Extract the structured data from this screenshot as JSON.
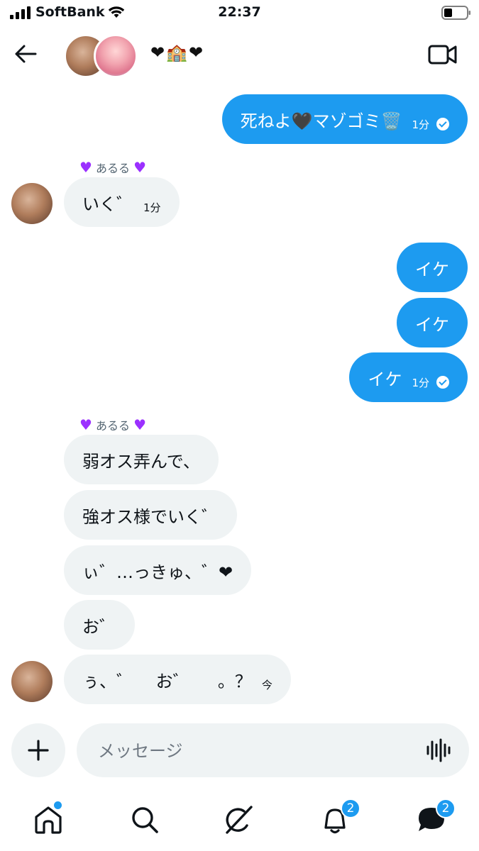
{
  "status_bar": {
    "carrier": "SoftBank",
    "time": "22:37"
  },
  "header": {
    "title": "❤🏫❤",
    "back_icon": "arrow-left-icon",
    "video_icon": "video-camera-icon"
  },
  "messages": [
    {
      "dir": "out",
      "text": "死ねよ🖤マゾゴミ🗑️",
      "time": "1分",
      "read": true
    },
    {
      "dir": "in",
      "sender": "あるる",
      "text": "いく゛",
      "time": "1分"
    },
    {
      "dir": "out",
      "text": "イケ"
    },
    {
      "dir": "out",
      "text": "イケ"
    },
    {
      "dir": "out",
      "text": "イケ",
      "time": "1分",
      "read": true
    },
    {
      "dir": "in",
      "sender": "あるる",
      "text": "弱オス弄んで、"
    },
    {
      "dir": "in",
      "text": "強オス様でいく゛"
    },
    {
      "dir": "in",
      "text": "ぃ゛…っきゅ、゛❤"
    },
    {
      "dir": "in",
      "text": "お゛"
    },
    {
      "dir": "in",
      "text": "ぅ、゛　 お゛ 　 。？",
      "time": "今"
    }
  ],
  "composer": {
    "placeholder": "メッセージ",
    "plus_icon": "plus-icon",
    "voice_icon": "voice-waveform-icon"
  },
  "nav": {
    "items": [
      {
        "name": "home",
        "icon": "home-icon"
      },
      {
        "name": "search",
        "icon": "search-icon"
      },
      {
        "name": "grok",
        "icon": "grok-icon"
      },
      {
        "name": "notifications",
        "icon": "bell-icon",
        "badge": "2"
      },
      {
        "name": "messages",
        "icon": "message-icon",
        "badge": "2"
      }
    ]
  },
  "colors": {
    "accent": "#1d9bf0",
    "incoming_bubble": "#eff3f4",
    "sender_heart": "#9b30ff"
  }
}
